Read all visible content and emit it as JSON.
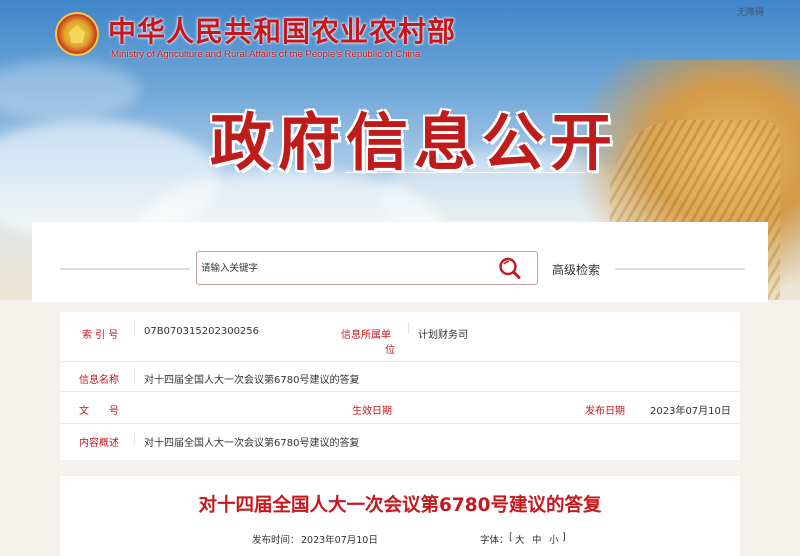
{
  "header": {
    "ministry_cn": "中华人民共和国农业农村部",
    "ministry_en": "Ministry of Agriculture and Rural Affairs of the People's Republic of China",
    "accessible_label": "无障碍",
    "banner_title": "政府信息公开"
  },
  "search": {
    "placeholder": "请输入关键字",
    "advanced_label": "高级检索"
  },
  "info": {
    "index_label": "索 引 号",
    "index_value": "07B070315202300256",
    "agency_label_line1": "信息所属单",
    "agency_label_line2": "位",
    "agency_value": "计划财务司",
    "name_label": "信息名称",
    "name_value": "对十四届全国人大一次会议第6780号建议的答复",
    "docno_label": "文　　号",
    "docno_value": "",
    "effective_label": "生效日期",
    "effective_value": "",
    "publish_label": "发布日期",
    "publish_value": "2023年07月10日",
    "summary_label": "内容概述",
    "summary_value": "对十四届全国人大一次会议第6780号建议的答复"
  },
  "article": {
    "title": "对十四届全国人大一次会议第6780号建议的答复",
    "publish_time_label": "发布时间：",
    "publish_time_value": "2023年07月10日",
    "font_label": "字体：",
    "font_open": "[",
    "font_large": "大",
    "font_medium": "中",
    "font_small": "小",
    "font_close": "]"
  },
  "colors": {
    "brand_red": "#c8161d",
    "sky_blue": "#3f86c9"
  }
}
